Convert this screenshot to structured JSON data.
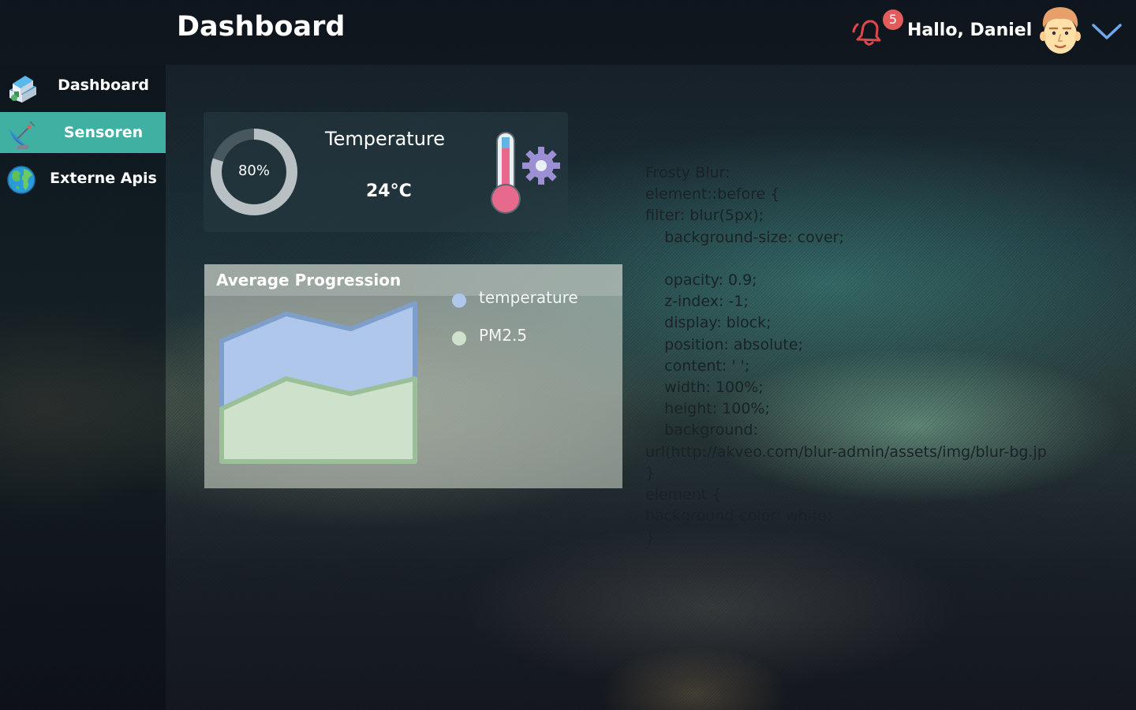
{
  "header": {
    "title": "Dashboard",
    "notification_count": "5",
    "greeting": "Hallo, Daniel",
    "icons": {
      "bell": "bell-icon",
      "avatar": "avatar-icon",
      "menu": "chevron-down-icon"
    }
  },
  "sidebar": {
    "items": [
      {
        "label": "Dashboard",
        "icon": "house-icon",
        "active": false
      },
      {
        "label": "Sensoren",
        "icon": "satellite-dish-icon",
        "active": true
      },
      {
        "label": "Externe Apis",
        "icon": "globe-icon",
        "active": false
      }
    ]
  },
  "temperature_card": {
    "gauge_label": "80%",
    "gauge_value": 0.8,
    "title": "Temperature",
    "value": "24°C",
    "icon": "thermometer-gear-icon"
  },
  "chart_card": {
    "title": "Average Progression",
    "chart_data": {
      "type": "area",
      "title": "Average Progression",
      "x": [
        0,
        1,
        2,
        3
      ],
      "series": [
        {
          "name": "temperature",
          "values": [
            0.8,
            0.98,
            0.88,
            1.05
          ],
          "color": "#aec7ea"
        },
        {
          "name": "PM2.5",
          "values": [
            0.35,
            0.55,
            0.45,
            0.55
          ],
          "color": "#cde1cb"
        }
      ],
      "legend": "right",
      "grid": false
    }
  },
  "code_note": {
    "lines": [
      "Frosty Blur:",
      "element::before {",
      "filter: blur(5px);",
      "    background-size: cover;",
      "",
      "    opacity: 0.9;",
      "    z-index: -1;",
      "    display: block;",
      "    position: absolute;",
      "    content: ' ';",
      "    width: 100%;",
      "    height: 100%;",
      "    background:",
      "url(http://akveo.com/blur-admin/assets/img/blur-bg.jp",
      "}",
      "element {",
      "background-color: white;",
      "}"
    ]
  },
  "colors": {
    "accent": "#3fb0a2",
    "badge": "#e25c5c",
    "temperature_series": "#aec7ea",
    "pm25_series": "#cde1cb"
  }
}
